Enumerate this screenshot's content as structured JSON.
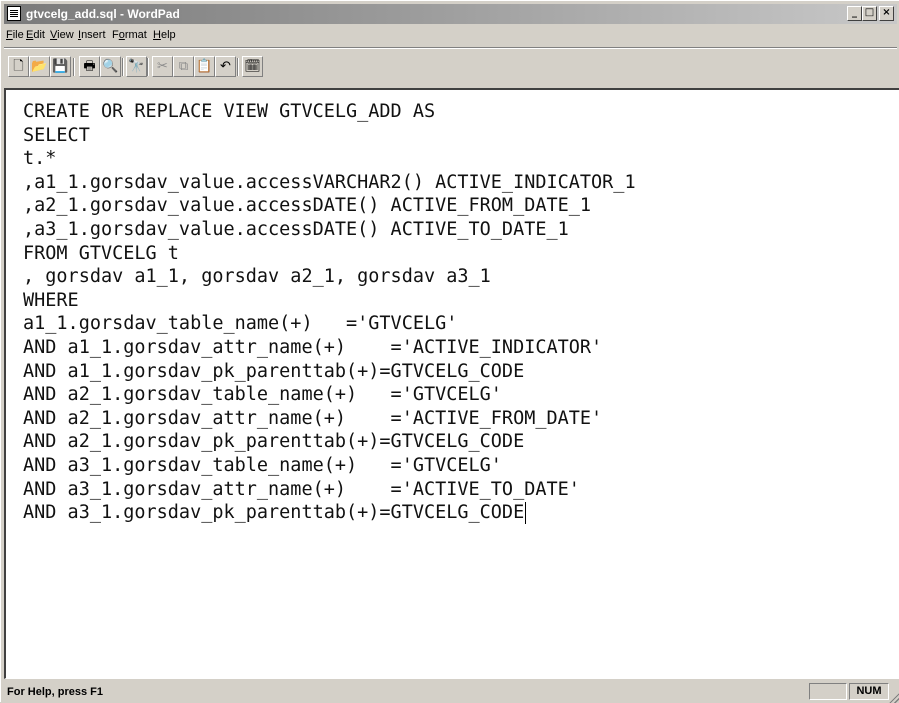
{
  "window": {
    "title": "gtvcelg_add.sql - WordPad"
  },
  "window_controls": {
    "minimize": "_",
    "maximize": "□",
    "close": "×"
  },
  "menu": {
    "items": [
      {
        "accel": "F",
        "rest": "ile"
      },
      {
        "accel": "E",
        "rest": "dit"
      },
      {
        "accel": "V",
        "rest": "iew"
      },
      {
        "accel": "I",
        "rest": "nsert"
      },
      {
        "pre": "F",
        "accel": "o",
        "rest": "rmat"
      },
      {
        "accel": "H",
        "rest": "elp"
      }
    ]
  },
  "toolbar": {
    "buttons": [
      {
        "name": "new-icon",
        "glyph": "🗋",
        "enabled": true
      },
      {
        "name": "open-icon",
        "glyph": "📂",
        "enabled": true
      },
      {
        "name": "save-icon",
        "glyph": "💾",
        "enabled": true
      },
      {
        "name": "print-icon",
        "glyph": "🖶",
        "enabled": true
      },
      {
        "name": "print-preview-icon",
        "glyph": "🔍",
        "enabled": true
      },
      {
        "name": "find-icon",
        "glyph": "🔭",
        "enabled": true
      },
      {
        "name": "cut-icon",
        "glyph": "✂",
        "enabled": false
      },
      {
        "name": "copy-icon",
        "glyph": "⧉",
        "enabled": false
      },
      {
        "name": "paste-icon",
        "glyph": "📋",
        "enabled": true
      },
      {
        "name": "undo-icon",
        "glyph": "↶",
        "enabled": true
      },
      {
        "name": "date-time-icon",
        "glyph": "🗓",
        "enabled": true
      }
    ]
  },
  "document": {
    "lines": [
      "CREATE OR REPLACE VIEW GTVCELG_ADD AS",
      "SELECT",
      "t.*",
      ",a1_1.gorsdav_value.accessVARCHAR2() ACTIVE_INDICATOR_1",
      ",a2_1.gorsdav_value.accessDATE() ACTIVE_FROM_DATE_1",
      ",a3_1.gorsdav_value.accessDATE() ACTIVE_TO_DATE_1",
      "FROM GTVCELG t",
      ", gorsdav a1_1, gorsdav a2_1, gorsdav a3_1",
      "WHERE",
      "a1_1.gorsdav_table_name(+)   ='GTVCELG'",
      "AND a1_1.gorsdav_attr_name(+)    ='ACTIVE_INDICATOR'",
      "AND a1_1.gorsdav_pk_parenttab(+)=GTVCELG_CODE",
      "AND a2_1.gorsdav_table_name(+)   ='GTVCELG'",
      "AND a2_1.gorsdav_attr_name(+)    ='ACTIVE_FROM_DATE'",
      "AND a2_1.gorsdav_pk_parenttab(+)=GTVCELG_CODE",
      "AND a3_1.gorsdav_table_name(+)   ='GTVCELG'",
      "AND a3_1.gorsdav_attr_name(+)    ='ACTIVE_TO_DATE'",
      "AND a3_1.gorsdav_pk_parenttab(+)=GTVCELG_CODE"
    ]
  },
  "statusbar": {
    "help_text": "For Help, press F1",
    "num_indicator": "NUM"
  }
}
